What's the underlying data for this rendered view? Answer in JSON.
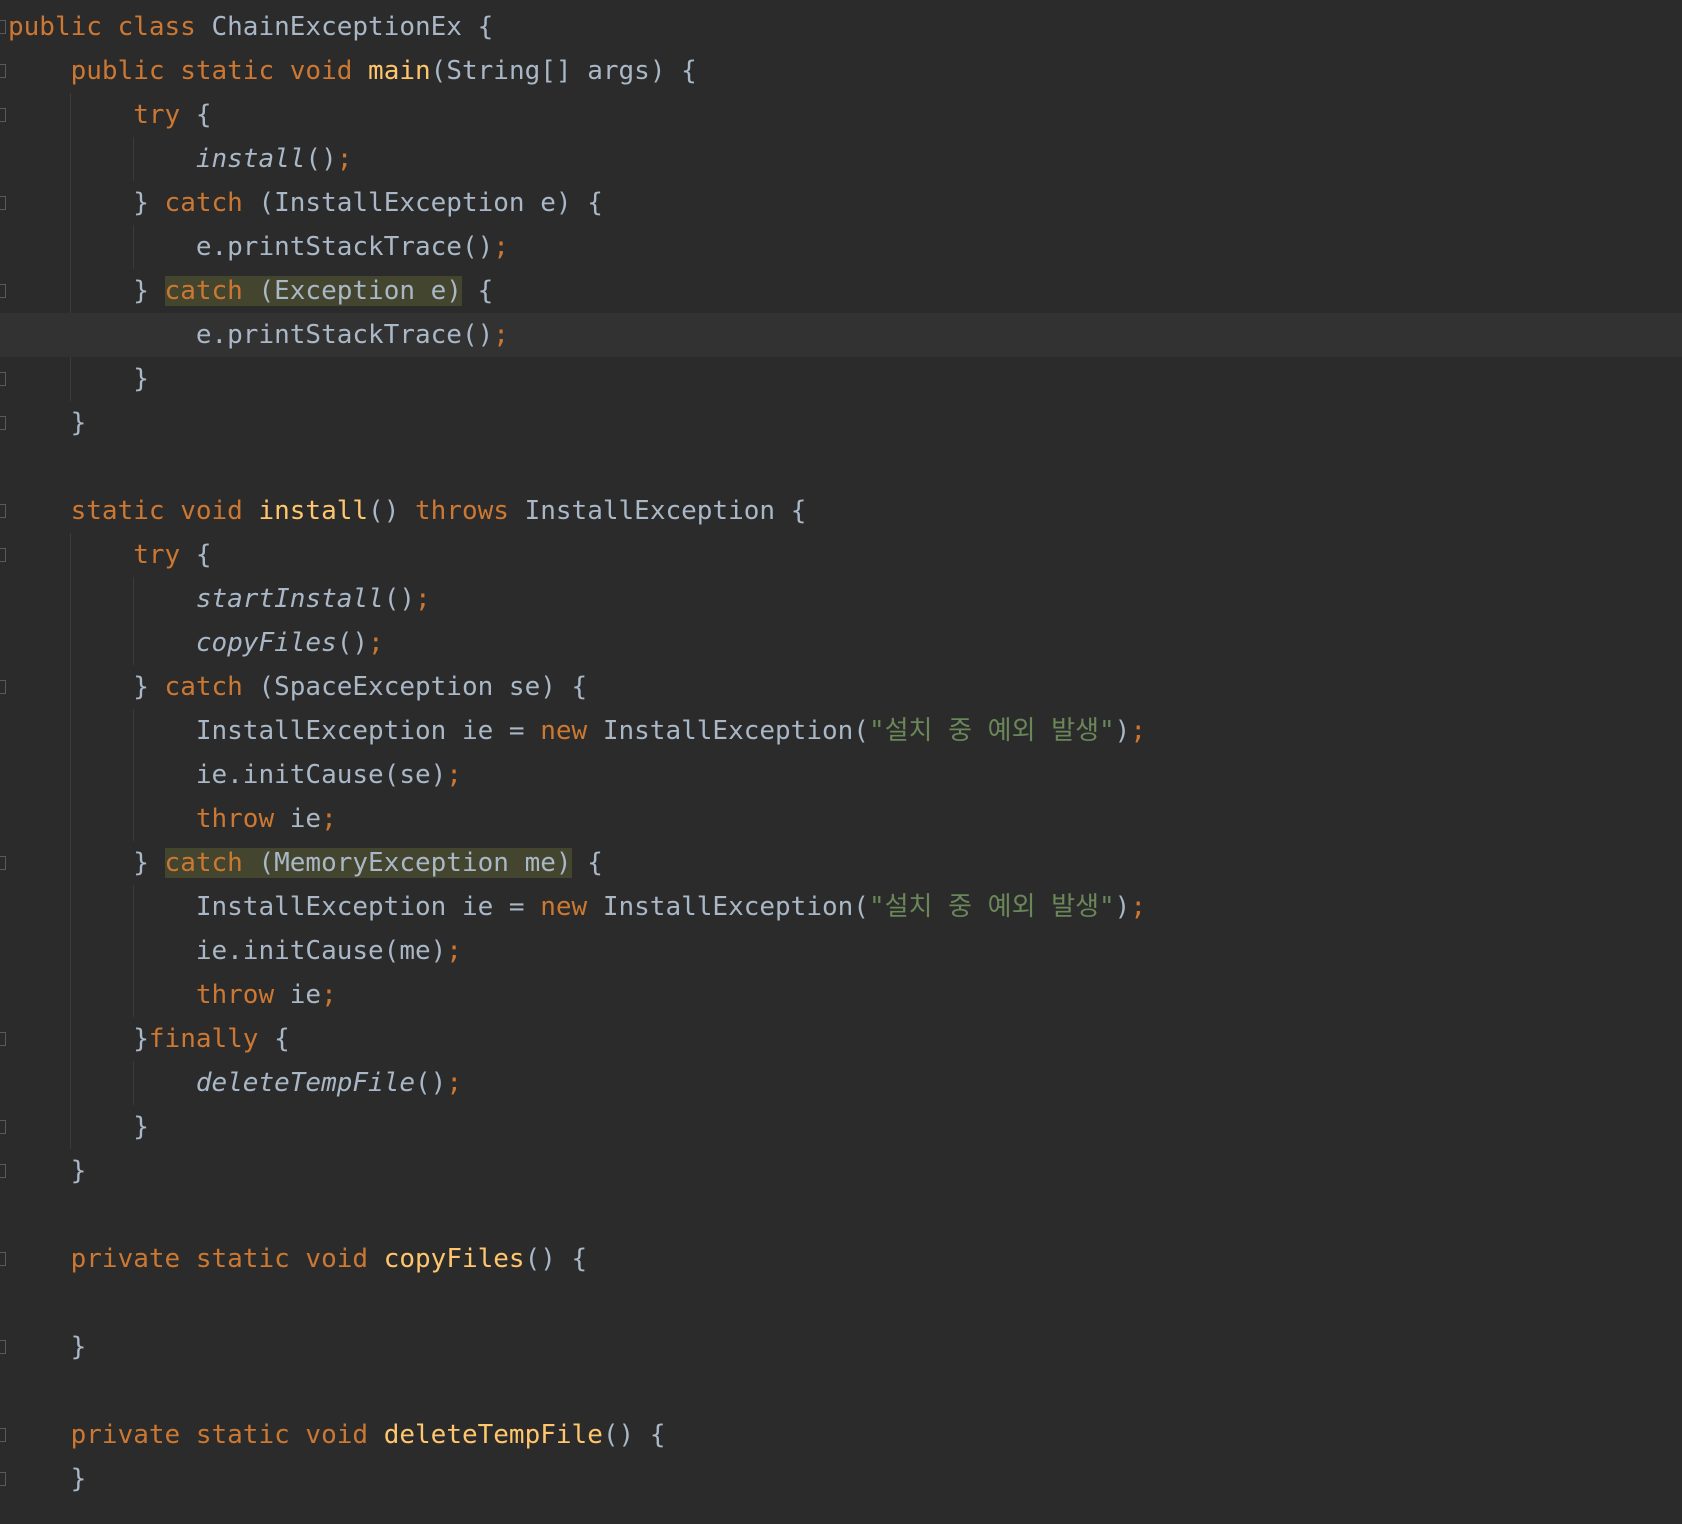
{
  "editor": {
    "lines": [
      [
        {
          "t": "public class ",
          "c": "kw"
        },
        {
          "t": "ChainExceptionEx {"
        }
      ],
      [
        {
          "t": "    "
        },
        {
          "t": "public static void ",
          "c": "kw"
        },
        {
          "t": "main",
          "c": "fn"
        },
        {
          "t": "(String[] args) {"
        }
      ],
      [
        {
          "t": "        "
        },
        {
          "t": "try ",
          "c": "kw"
        },
        {
          "t": "{"
        }
      ],
      [
        {
          "t": "            "
        },
        {
          "t": "install",
          "c": "it"
        },
        {
          "t": "()"
        },
        {
          "t": ";",
          "c": "kw"
        }
      ],
      [
        {
          "t": "        } "
        },
        {
          "t": "catch ",
          "c": "kw"
        },
        {
          "t": "(InstallException e) {"
        }
      ],
      [
        {
          "t": "            e.printStackTrace()"
        },
        {
          "t": ";",
          "c": "kw"
        }
      ],
      [
        {
          "t": "        } "
        },
        {
          "t": "catch ",
          "c": "kw hl"
        },
        {
          "t": "(Exception e)",
          "c": "hl"
        },
        {
          "t": " {"
        }
      ],
      [
        {
          "t": "            e.printStackTrace()"
        },
        {
          "t": ";",
          "c": "kw"
        }
      ],
      [
        {
          "t": "        }"
        }
      ],
      [
        {
          "t": "    }"
        }
      ],
      [],
      [
        {
          "t": "    "
        },
        {
          "t": "static void ",
          "c": "kw"
        },
        {
          "t": "install",
          "c": "fn"
        },
        {
          "t": "() "
        },
        {
          "t": "throws ",
          "c": "kw"
        },
        {
          "t": "InstallException {"
        }
      ],
      [
        {
          "t": "        "
        },
        {
          "t": "try ",
          "c": "kw"
        },
        {
          "t": "{"
        }
      ],
      [
        {
          "t": "            "
        },
        {
          "t": "startInstall",
          "c": "it"
        },
        {
          "t": "()"
        },
        {
          "t": ";",
          "c": "kw"
        }
      ],
      [
        {
          "t": "            "
        },
        {
          "t": "copyFiles",
          "c": "it"
        },
        {
          "t": "()"
        },
        {
          "t": ";",
          "c": "kw"
        }
      ],
      [
        {
          "t": "        } "
        },
        {
          "t": "catch ",
          "c": "kw"
        },
        {
          "t": "(SpaceException se) {"
        }
      ],
      [
        {
          "t": "            InstallException ie = "
        },
        {
          "t": "new ",
          "c": "kw"
        },
        {
          "t": "InstallException("
        },
        {
          "t": "\"설치 중 예외 발생\"",
          "c": "st"
        },
        {
          "t": ")"
        },
        {
          "t": ";",
          "c": "kw"
        }
      ],
      [
        {
          "t": "            ie.initCause(se)"
        },
        {
          "t": ";",
          "c": "kw"
        }
      ],
      [
        {
          "t": "            "
        },
        {
          "t": "throw ",
          "c": "kw"
        },
        {
          "t": "ie"
        },
        {
          "t": ";",
          "c": "kw"
        }
      ],
      [
        {
          "t": "        } "
        },
        {
          "t": "catch ",
          "c": "kw hl"
        },
        {
          "t": "(MemoryException me)",
          "c": "hl"
        },
        {
          "t": " {"
        }
      ],
      [
        {
          "t": "            InstallException ie = "
        },
        {
          "t": "new ",
          "c": "kw"
        },
        {
          "t": "InstallException("
        },
        {
          "t": "\"설치 중 예외 발생\"",
          "c": "st"
        },
        {
          "t": ")"
        },
        {
          "t": ";",
          "c": "kw"
        }
      ],
      [
        {
          "t": "            ie.initCause(me)"
        },
        {
          "t": ";",
          "c": "kw"
        }
      ],
      [
        {
          "t": "            "
        },
        {
          "t": "throw ",
          "c": "kw"
        },
        {
          "t": "ie"
        },
        {
          "t": ";",
          "c": "kw"
        }
      ],
      [
        {
          "t": "        }"
        },
        {
          "t": "finally ",
          "c": "kw"
        },
        {
          "t": "{"
        }
      ],
      [
        {
          "t": "            "
        },
        {
          "t": "deleteTempFile",
          "c": "it"
        },
        {
          "t": "()"
        },
        {
          "t": ";",
          "c": "kw"
        }
      ],
      [
        {
          "t": "        }"
        }
      ],
      [
        {
          "t": "    }"
        }
      ],
      [],
      [
        {
          "t": "    "
        },
        {
          "t": "private static void ",
          "c": "kw"
        },
        {
          "t": "copyFiles",
          "c": "fn"
        },
        {
          "t": "() {"
        }
      ],
      [],
      [
        {
          "t": "    }"
        }
      ],
      [],
      [
        {
          "t": "    "
        },
        {
          "t": "private static void ",
          "c": "kw"
        },
        {
          "t": "deleteTempFile",
          "c": "fn"
        },
        {
          "t": "() {"
        }
      ],
      [
        {
          "t": "    }"
        }
      ]
    ]
  }
}
